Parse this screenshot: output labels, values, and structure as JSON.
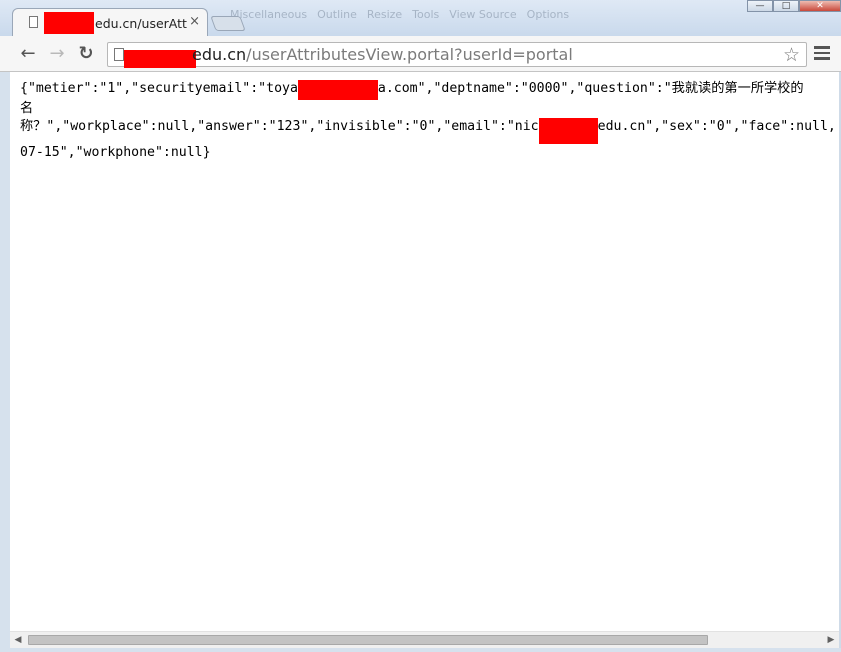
{
  "window": {
    "minimize_label": "—",
    "maximize_label": "□",
    "close_label": "✕"
  },
  "ghost_toolbar": [
    "Miscellaneous",
    "Outline",
    "Resize",
    "Tools",
    "View Source",
    "Options"
  ],
  "tab": {
    "title": "edu.cn/userAttr",
    "close_label": "×"
  },
  "nav": {
    "back_label": "←",
    "forward_label": "→",
    "reload_label": "↻"
  },
  "address": {
    "host_suffix": "edu.cn",
    "path": "/userAttributesView.portal?userId=portal"
  },
  "star_label": "☆",
  "json": {
    "line1_a": "{\"metier\":\"1\",\"securityemail\":\"toya",
    "line1_b": "a.com\",\"deptname\":\"0000\",\"question\":\"我就读的第一所学校的",
    "line2": "名",
    "line3_a": "称？\",\"workplace\":null,\"answer\":\"123\",\"invisible\":\"0\",\"email\":\"nic",
    "line3_b": "edu.cn\",\"sex\":\"0\",\"face\":null,",
    "line4": "07-15\",\"workphone\":null}"
  },
  "scrollbar": {
    "left_arrow": "◀",
    "right_arrow": "▶"
  },
  "colors": {
    "redaction": "#ff0000",
    "chrome_frame": "#cfdbe8"
  }
}
